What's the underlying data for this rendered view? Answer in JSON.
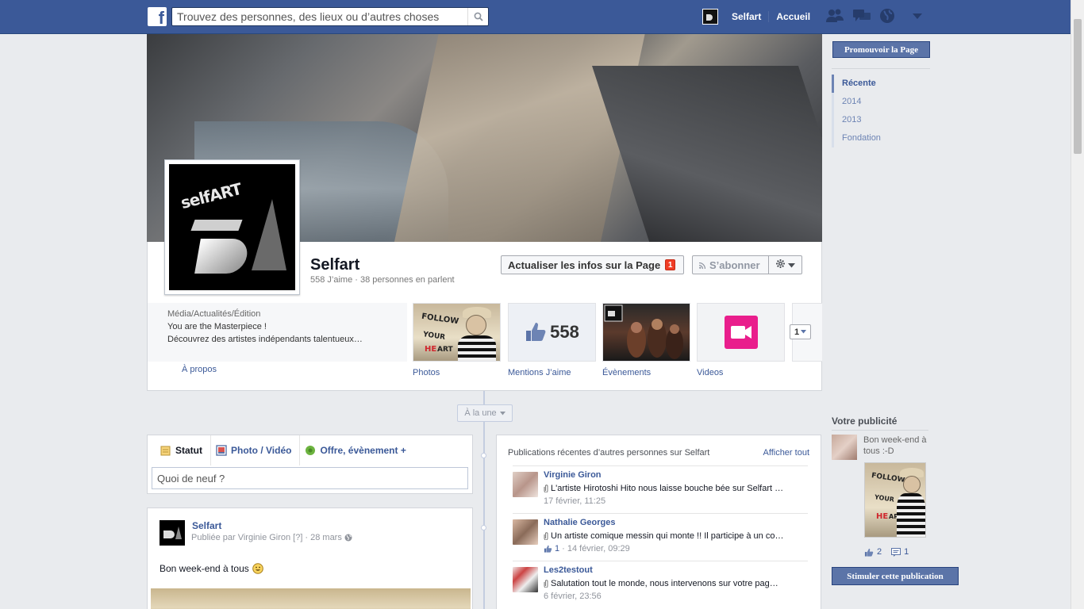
{
  "topbar": {
    "logo": "f",
    "search_placeholder": "Trouvez des personnes, des lieux ou d’autres choses",
    "user_name": "Selfart",
    "home": "Accueil"
  },
  "page": {
    "name": "Selfart",
    "stats": "558 J’aime · 38 personnes en parlent",
    "update_label": "Actualiser les infos sur la Page",
    "update_badge": "1",
    "subscribe_label": "S’abonner"
  },
  "about": {
    "category": "Média/Actualités/Édition",
    "line1": "You are the Masterpiece !",
    "line2": "Découvrez des artistes indépendants talentueux…",
    "link": "À propos"
  },
  "tiles": {
    "photos": "Photos",
    "likes": "Mentions J’aime",
    "likes_count": "558",
    "events": "Évènements",
    "videos": "Videos",
    "more": "1"
  },
  "timeline": {
    "highlight": "À la une"
  },
  "composer": {
    "tab_status": "Statut",
    "tab_photo": "Photo / Vidéo",
    "tab_offer": "Offre, évènement +",
    "placeholder": "Quoi de neuf ?"
  },
  "post": {
    "author": "Selfart",
    "meta_prefix": "Publiée par Virginie Giron",
    "meta_q": "[?]",
    "meta_date": "· 28 mars",
    "text": "Bon week-end à tous"
  },
  "recent": {
    "title": "Publications récentes d’autres personnes sur Selfart",
    "see_all": "Afficher tout",
    "items": [
      {
        "name": "Virginie Giron",
        "text": "L'artiste Hirotoshi Hito nous laisse bouche bée sur Selfart …",
        "date": "17 février, 11:25",
        "likes": ""
      },
      {
        "name": "Nathalie Georges",
        "text": "Un artiste comique messin qui monte !! Il participe à un co…",
        "date": "· 14 février, 09:29",
        "likes": "1"
      },
      {
        "name": "Les2testout",
        "text": "Salutation tout le monde, nous intervenons sur votre pag…",
        "date": "6 février, 23:56",
        "likes": ""
      }
    ]
  },
  "sidebar": {
    "promote": "Promouvoir la Page",
    "years": [
      "Récente",
      "2014",
      "2013",
      "Fondation"
    ]
  },
  "ads": {
    "title": "Votre publicité",
    "text": "Bon week-end à tous :-D",
    "likes": "2",
    "comments": "1",
    "boost": "Stimuler cette publication"
  },
  "art": {
    "line1": "FOLLOW",
    "line2": "YOUR",
    "line3a": "HE",
    "line3b": "ART"
  },
  "colors": {
    "brand": "#3b5998",
    "badge": "#f03d25",
    "video": "#e91e8c"
  }
}
